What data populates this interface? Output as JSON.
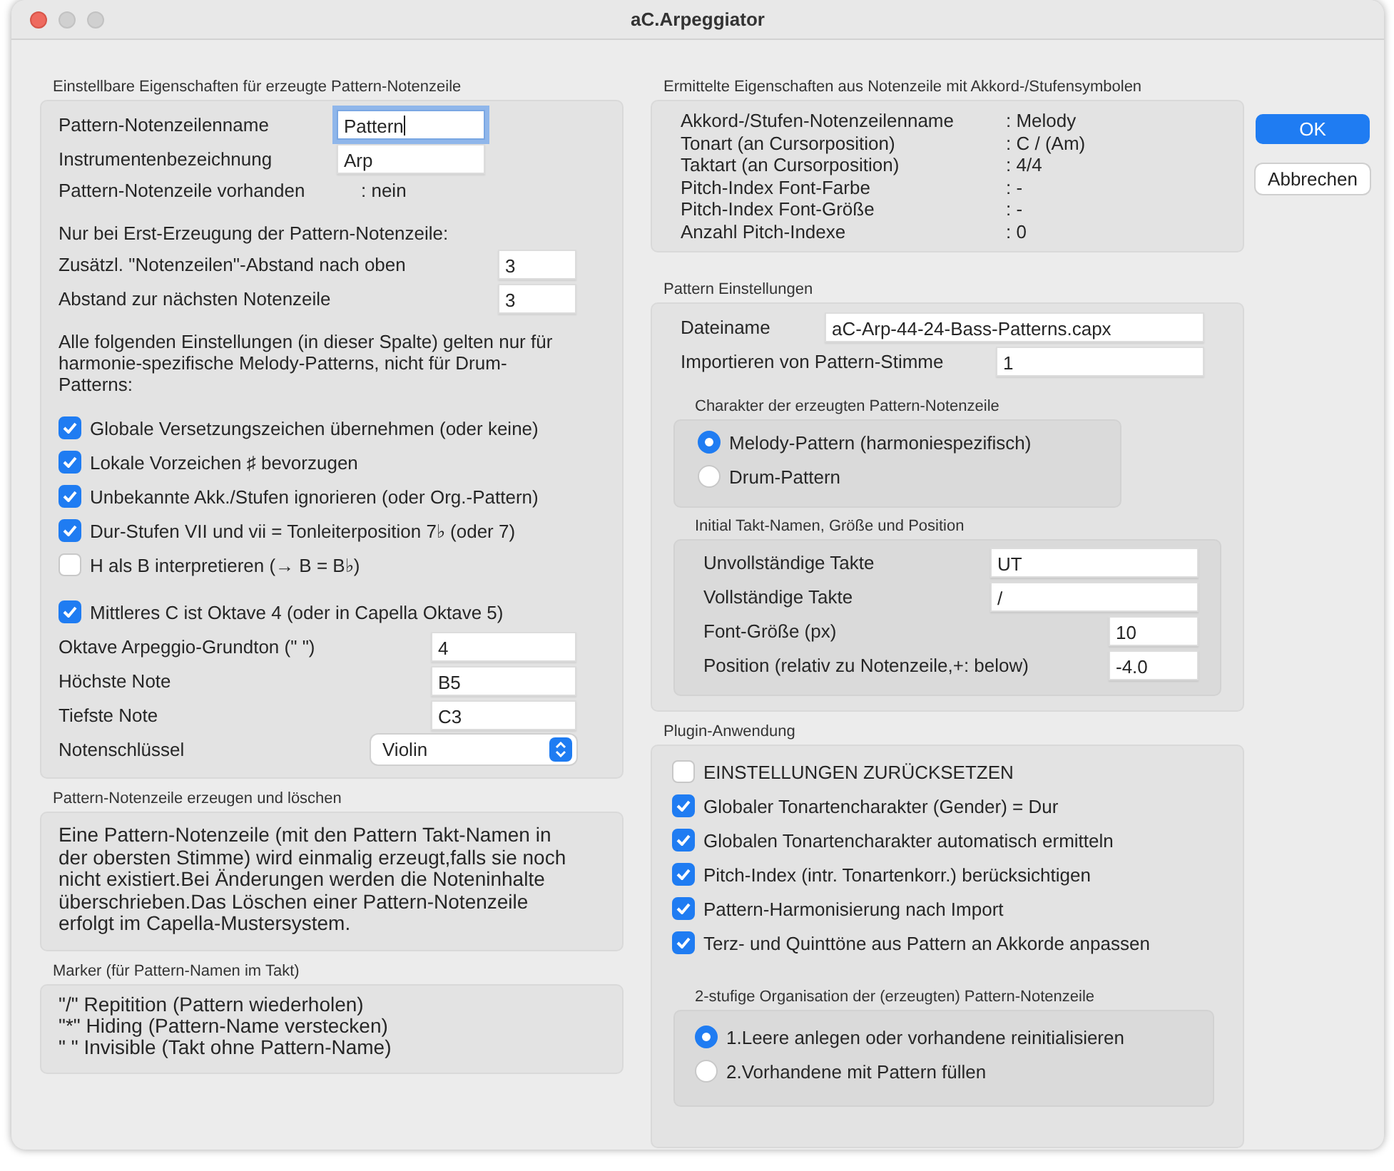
{
  "window": {
    "title": "aC.Arpeggiator"
  },
  "left_column": [
    {
      "title": "Einstellbare Eigenschaften für erzeugte Pattern-Notenzeile",
      "blocks": [
        [
          {
            "kind": "field",
            "label": "Pattern-Notenzeilenname",
            "value": "Pattern",
            "focused": true
          },
          {
            "kind": "field",
            "label": "Instrumentenbezeichnung",
            "value": "Arp",
            "focused": false
          },
          {
            "kind": "info",
            "label": "Pattern-Notenzeile vorhanden",
            "value": ": nein"
          }
        ],
        [
          {
            "kind": "text",
            "text": "Nur bei Erst-Erzeugung der Pattern-Notenzeile:"
          },
          {
            "kind": "field",
            "label": "Zusätzl. \"Notenzeilen\"-Abstand nach oben",
            "value": "3",
            "focused": false
          },
          {
            "kind": "field",
            "label": "Abstand zur nächsten Notenzeile",
            "value": "3",
            "focused": false
          }
        ],
        [
          {
            "kind": "text",
            "text": "Alle folgenden Einstellungen (in dieser Spalte) gelten nur für harmonie-spezifische Melody-Patterns, nicht für Drum-Patterns:"
          }
        ],
        [
          {
            "kind": "checkbox",
            "label": "Globale Versetzungszeichen übernehmen (oder keine)",
            "checked": true
          },
          {
            "kind": "checkbox",
            "label": "Lokale Vorzeichen ♯ bevorzugen",
            "checked": true
          },
          {
            "kind": "checkbox",
            "label": "Unbekannte Akk./Stufen ignorieren (oder Org.-Pattern)",
            "checked": true
          },
          {
            "kind": "checkbox",
            "label": "Dur-Stufen VII und vii = Tonleiterposition 7♭ (oder 7)",
            "checked": true
          },
          {
            "kind": "checkbox",
            "label": "H als B interpretieren (→ B = B♭)",
            "checked": false
          }
        ],
        [
          {
            "kind": "checkbox",
            "label": "Mittleres C ist Oktave 4 (oder in Capella Oktave 5)",
            "checked": true
          },
          {
            "kind": "field",
            "label": "Oktave Arpeggio-Grundton (\" \")",
            "value": "4",
            "focused": false
          },
          {
            "kind": "field",
            "label": "Höchste Note",
            "value": "B5",
            "focused": false
          },
          {
            "kind": "field",
            "label": "Tiefste Note",
            "value": "C3",
            "focused": false
          },
          {
            "kind": "select",
            "label": "Notenschlüssel",
            "value": "Violin"
          }
        ]
      ]
    },
    {
      "title": "Pattern-Notenzeile erzeugen und löschen",
      "blocks": [
        [
          {
            "kind": "text",
            "text": "Eine Pattern-Notenzeile (mit den Pattern Takt-Namen in der obersten Stimme) wird einmalig erzeugt,falls sie noch nicht existiert.Bei Änderungen werden die Noteninhalte überschrieben.Das Löschen einer Pattern-Notenzeile erfolgt im Capella-Mustersystem."
          }
        ]
      ]
    },
    {
      "title": "Marker (für Pattern-Namen im Takt)",
      "blocks": [
        [
          {
            "kind": "text",
            "text": "\"/\" Repitition (Pattern wiederholen)"
          },
          {
            "kind": "text",
            "text": "\"*\" Hiding (Pattern-Name verstecken)"
          },
          {
            "kind": "text",
            "text": "\" \" Invisible (Takt ohne Pattern-Name)"
          }
        ]
      ]
    }
  ],
  "right_column": [
    {
      "title": "Ermittelte Eigenschaften aus Notenzeile mit Akkord-/Stufensymbolen",
      "blocks": [
        [
          {
            "kind": "info",
            "label": "Akkord-/Stufen-Notenzeilenname",
            "value": ": Melody"
          },
          {
            "kind": "info",
            "label": "Tonart (an Cursorposition)",
            "value": ": C / (Am)"
          },
          {
            "kind": "info",
            "label": "Taktart (an Cursorposition)",
            "value": ": 4/4"
          },
          {
            "kind": "info",
            "label": "Pitch-Index Font-Farbe",
            "value": ": -"
          },
          {
            "kind": "info",
            "label": "Pitch-Index Font-Größe",
            "value": ": -"
          },
          {
            "kind": "info",
            "label": "Anzahl Pitch-Indexe",
            "value": ": 0"
          }
        ]
      ]
    },
    {
      "title": "Pattern Einstellungen",
      "blocks": [
        [
          {
            "kind": "field",
            "label": "Dateiname",
            "value": "aC-Arp-44-24-Bass-Patterns.capx",
            "focused": false
          },
          {
            "kind": "field",
            "label": "Importieren von Pattern-Stimme",
            "value": "1",
            "focused": false
          }
        ],
        [
          {
            "kind": "group",
            "title": "Charakter der erzeugten Pattern-Notenzeile",
            "blocks": [
              [
                {
                  "kind": "radio",
                  "label": "Melody-Pattern (harmoniespezifisch)",
                  "selected": true
                },
                {
                  "kind": "radio",
                  "label": "Drum-Pattern",
                  "selected": false
                }
              ]
            ]
          },
          {
            "kind": "group",
            "title": "Initial Takt-Namen, Größe und Position",
            "blocks": [
              [
                {
                  "kind": "field",
                  "label": "Unvollständige Takte",
                  "value": "UT",
                  "focused": false
                },
                {
                  "kind": "field",
                  "label": "Vollständige Takte",
                  "value": "/",
                  "focused": false
                },
                {
                  "kind": "field",
                  "label": "Font-Größe (px)",
                  "value": "10",
                  "focused": false
                },
                {
                  "kind": "field",
                  "label": "Position (relativ zu Notenzeile,+: below)",
                  "value": "-4.0",
                  "focused": false
                }
              ]
            ]
          }
        ]
      ]
    },
    {
      "title": "Plugin-Anwendung",
      "blocks": [
        [
          {
            "kind": "checkbox",
            "label": "EINSTELLUNGEN ZURÜCKSETZEN",
            "checked": false
          },
          {
            "kind": "checkbox",
            "label": "Globaler Tonartencharakter (Gender) = Dur",
            "checked": true
          },
          {
            "kind": "checkbox",
            "label": "Globalen Tonartencharakter automatisch ermitteln",
            "checked": true
          },
          {
            "kind": "checkbox",
            "label": "Pitch-Index (intr. Tonartenkorr.) berücksichtigen",
            "checked": true
          },
          {
            "kind": "checkbox",
            "label": "Pattern-Harmonisierung nach Import",
            "checked": true
          },
          {
            "kind": "checkbox",
            "label": "Terz- und Quinttöne aus Pattern an Akkorde anpassen",
            "checked": true
          }
        ],
        [
          {
            "kind": "group",
            "title": "2-stufige Organisation der (erzeugten) Pattern-Notenzeile",
            "blocks": [
              [
                {
                  "kind": "radio",
                  "label": "1.Leere anlegen oder vorhandene reinitialisieren",
                  "selected": true
                },
                {
                  "kind": "radio",
                  "label": "2.Vorhandene mit Pattern füllen",
                  "selected": false
                }
              ]
            ]
          }
        ]
      ]
    }
  ],
  "buttons": [
    {
      "label": "OK",
      "kind": "default"
    },
    {
      "label": "Abbrechen",
      "kind": "normal"
    }
  ]
}
